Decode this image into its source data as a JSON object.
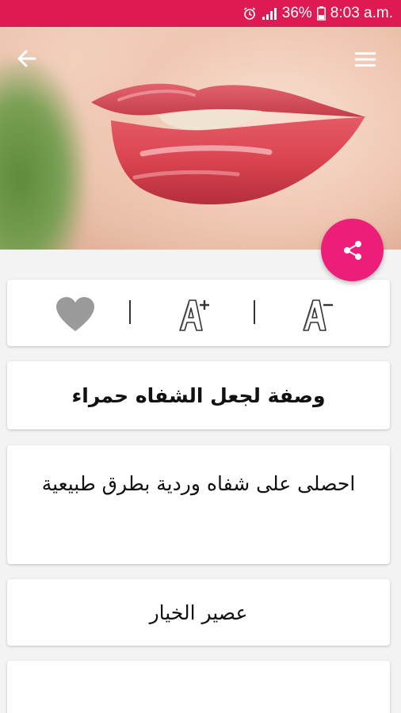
{
  "status_bar": {
    "battery_percent": "36%",
    "time": "8:03 a.m.",
    "icons": [
      "alarm-icon",
      "signal-icon",
      "battery-icon"
    ]
  },
  "header": {
    "back_icon": "arrow-left-icon",
    "menu_icon": "hamburger-menu-icon",
    "hero_image": "red-lips-photo"
  },
  "fab": {
    "icon": "share-icon",
    "color": "#ec1e79"
  },
  "toolbar": {
    "items": [
      {
        "icon": "favorite-heart-icon"
      },
      {
        "icon": "font-increase-icon"
      },
      {
        "icon": "font-decrease-icon"
      }
    ]
  },
  "recipe": {
    "title": "وصفة لجعل الشفاه حمراء",
    "description": "احصلى على شفاه وردية بطرق طبيعية",
    "ingredient": "عصير الخيار"
  },
  "colors": {
    "status_bar": "#de1a52",
    "accent": "#ec1e79",
    "background": "#f3f3f3"
  }
}
